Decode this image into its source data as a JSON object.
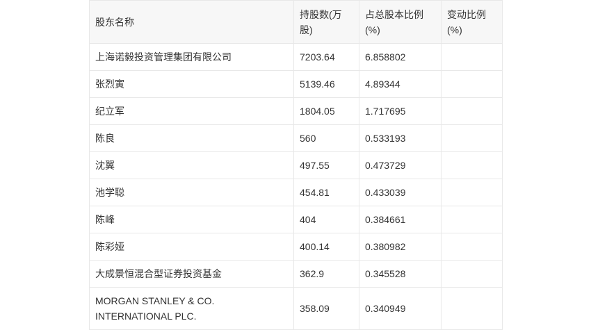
{
  "table": {
    "headers": [
      "股东名称",
      "持股数(万股)",
      "占总股本比例(%)",
      "变动比例(%)"
    ],
    "rows": [
      [
        "上海诺毅投资管理集团有限公司",
        "7203.64",
        "6.858802",
        ""
      ],
      [
        "张烈寅",
        "5139.46",
        "4.89344",
        ""
      ],
      [
        "纪立军",
        "1804.05",
        "1.717695",
        ""
      ],
      [
        "陈良",
        "560",
        "0.533193",
        ""
      ],
      [
        "沈翼",
        "497.55",
        "0.473729",
        ""
      ],
      [
        "池学聪",
        "454.81",
        "0.433039",
        ""
      ],
      [
        "陈峰",
        "404",
        "0.384661",
        ""
      ],
      [
        "陈彩娅",
        "400.14",
        "0.380982",
        ""
      ],
      [
        "大成景恒混合型证券投资基金",
        "362.9",
        "0.345528",
        ""
      ],
      [
        "MORGAN STANLEY & CO. INTERNATIONAL PLC.",
        "358.09",
        "0.340949",
        ""
      ]
    ]
  }
}
